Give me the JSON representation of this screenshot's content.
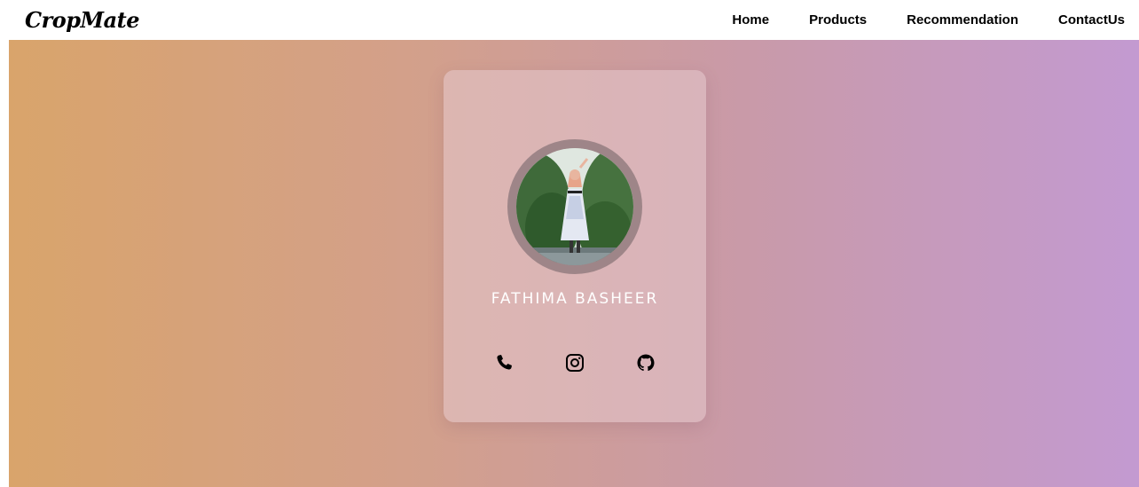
{
  "brand": {
    "logo_text": "CropMate"
  },
  "nav": {
    "items": [
      {
        "label": "Home"
      },
      {
        "label": "Products"
      },
      {
        "label": "Recommendation"
      },
      {
        "label": "ContactUs"
      }
    ]
  },
  "profile": {
    "name": "FATHIMA BASHEER",
    "socials": [
      {
        "icon": "phone-icon"
      },
      {
        "icon": "instagram-icon"
      },
      {
        "icon": "github-icon"
      }
    ]
  },
  "colors": {
    "gradient_start": "#d9a46b",
    "gradient_end": "#c39ad1",
    "avatar_ring": "#9e8588",
    "name_text": "#ffffff"
  }
}
